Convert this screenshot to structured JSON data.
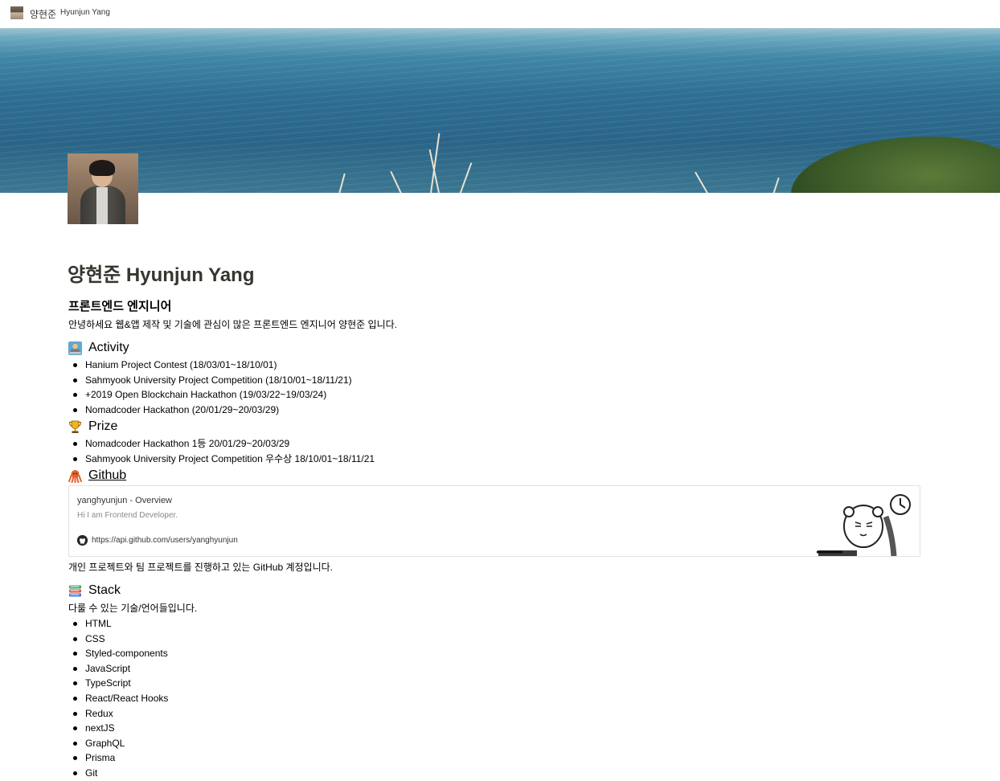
{
  "topbar": {
    "breadcrumb_ko": "양현준",
    "breadcrumb_en": "Hyunjun Yang"
  },
  "page": {
    "title": "양현준 Hyunjun Yang",
    "subtitle": "프론트엔드 엔지니어",
    "intro": "안녕하세요 웹&앱 제작 및 기술에 관심이 많은 프론트엔드 엔지니어 양현준 입니다."
  },
  "activity": {
    "heading": "Activity",
    "icon": "person-at-computer-icon",
    "items": [
      "Hanium Project Contest (18/03/01~18/10/01)",
      "Sahmyook University Project Competition (18/10/01~18/11/21)",
      "+2019 Open Blockchain Hackathon (19/03/22~19/03/24)",
      "Nomadcoder Hackathon (20/01/29~20/03/29)"
    ]
  },
  "prize": {
    "heading": "Prize",
    "icon": "trophy-icon",
    "items": [
      "Nomadcoder Hackathon 1등 20/01/29~20/03/29",
      "Sahmyook University Project Competition 우수상 18/10/01~18/11/21"
    ]
  },
  "github": {
    "heading": "Github",
    "icon": "octopus-icon",
    "bookmark": {
      "title": "yanghyunjun - Overview",
      "description": "Hi I am Frontend Developer.",
      "url": "https://api.github.com/users/yanghyunjun"
    },
    "note": "개인 프로젝트와 팀 프로젝트를 진행하고 있는 GitHub 계정입니다."
  },
  "stack": {
    "heading": "Stack",
    "icon": "books-icon",
    "note": "다룰 수 있는 기술/언어들입니다.",
    "items": [
      "HTML",
      "CSS",
      "Styled-components",
      "JavaScript",
      "TypeScript",
      "React/React Hooks",
      "Redux",
      "nextJS",
      "GraphQL",
      "Prisma",
      "Git"
    ]
  }
}
